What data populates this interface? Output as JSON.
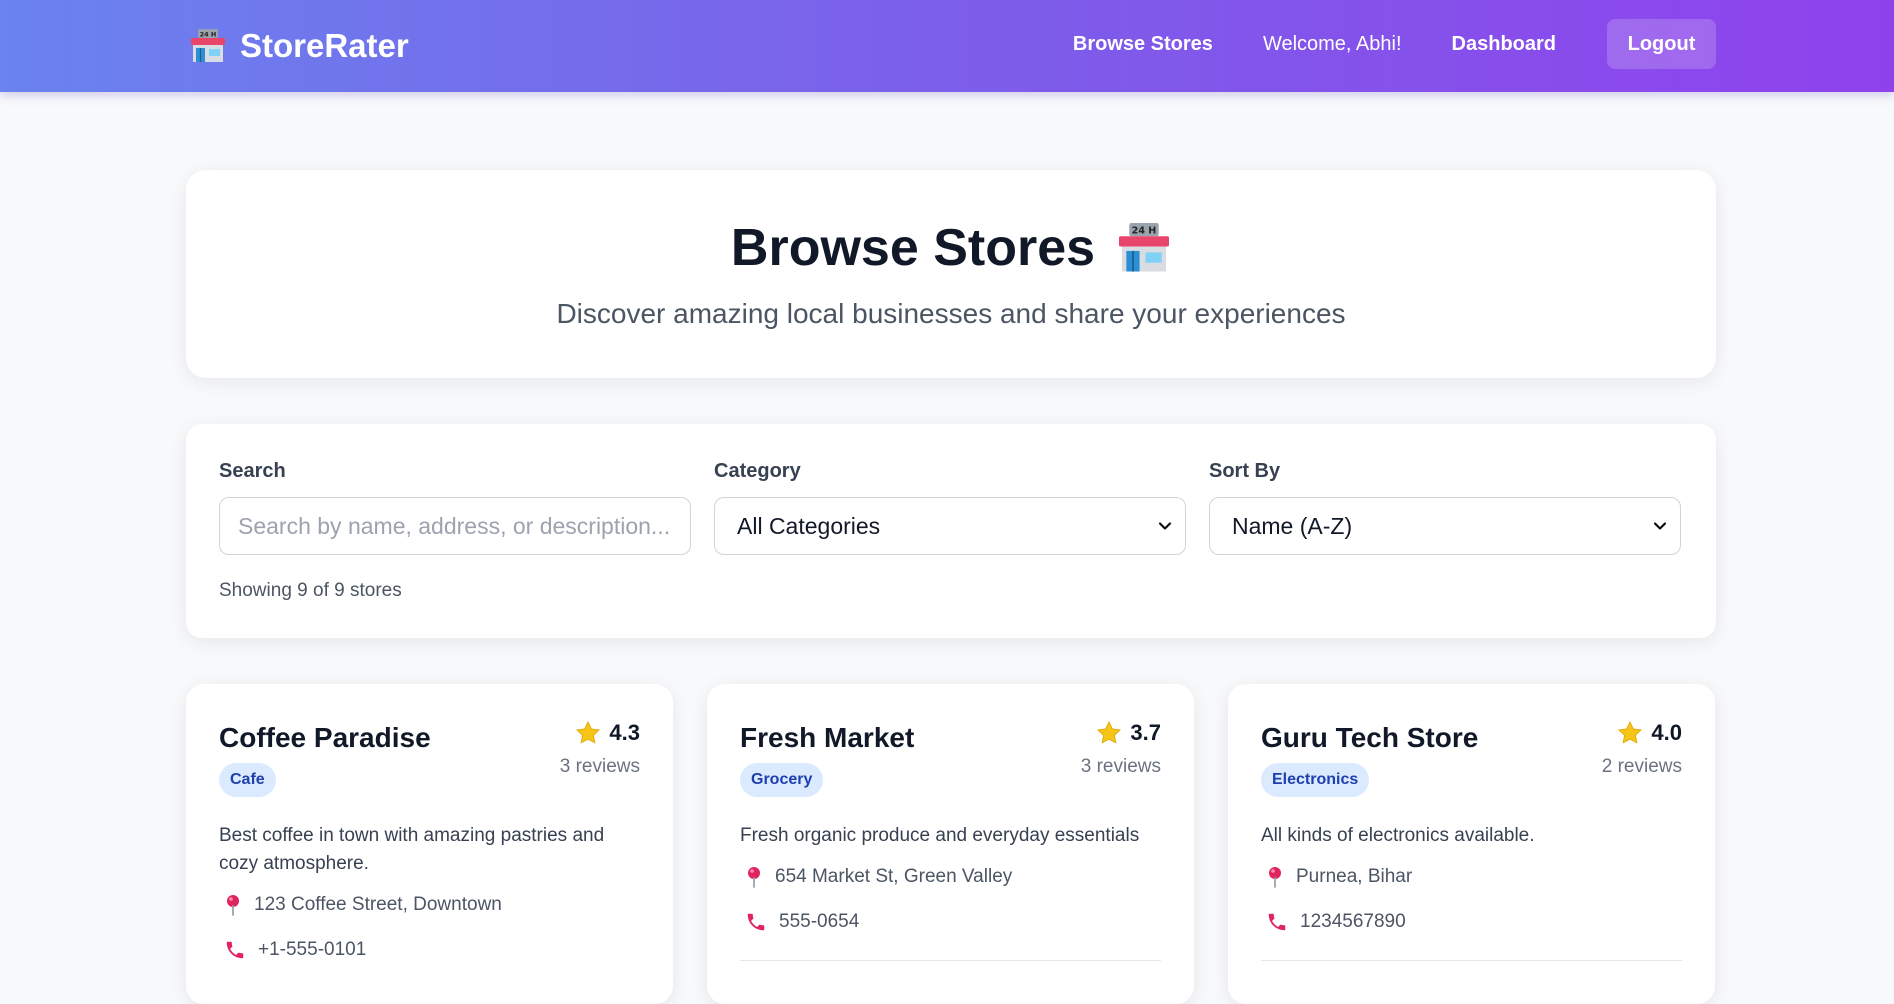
{
  "nav": {
    "brand": "StoreRater",
    "links": [
      "Browse Stores",
      "Welcome, Abhi!",
      "Dashboard"
    ],
    "logout": "Logout"
  },
  "hero": {
    "title": "Browse Stores",
    "subtitle": "Discover amazing local businesses and share your experiences"
  },
  "filters": {
    "search_label": "Search",
    "search_placeholder": "Search by name, address, or description...",
    "search_value": "",
    "category_label": "Category",
    "category_value": "All Categories",
    "sort_label": "Sort By",
    "sort_value": "Name (A-Z)",
    "showing": "Showing 9 of 9 stores"
  },
  "stores": [
    {
      "name": "Coffee Paradise",
      "rating": "4.3",
      "reviews": "3 reviews",
      "category": "Cafe",
      "description": "Best coffee in town with amazing pastries and cozy atmosphere.",
      "address": "123 Coffee Street, Downtown",
      "phone": "+1-555-0101"
    },
    {
      "name": "Fresh Market",
      "rating": "3.7",
      "reviews": "3 reviews",
      "category": "Grocery",
      "description": "Fresh organic produce and everyday essentials",
      "address": "654 Market St, Green Valley",
      "phone": "555-0654"
    },
    {
      "name": "Guru Tech Store",
      "rating": "4.0",
      "reviews": "2 reviews",
      "category": "Electronics",
      "description": "All kinds of electronics available.",
      "address": "Purnea, Bihar",
      "phone": "1234567890"
    }
  ],
  "icons": {
    "store": "convenience-store-24h-icon",
    "star": "star-icon",
    "pin": "map-pin-icon",
    "phone": "telephone-icon"
  },
  "colors": {
    "nav_gradient_start": "#6a83ee",
    "nav_gradient_end": "#8f42ec",
    "badge_bg": "#dbeafe",
    "badge_text": "#1e40af",
    "star": "#f5c518",
    "pin": "#e0245e"
  }
}
